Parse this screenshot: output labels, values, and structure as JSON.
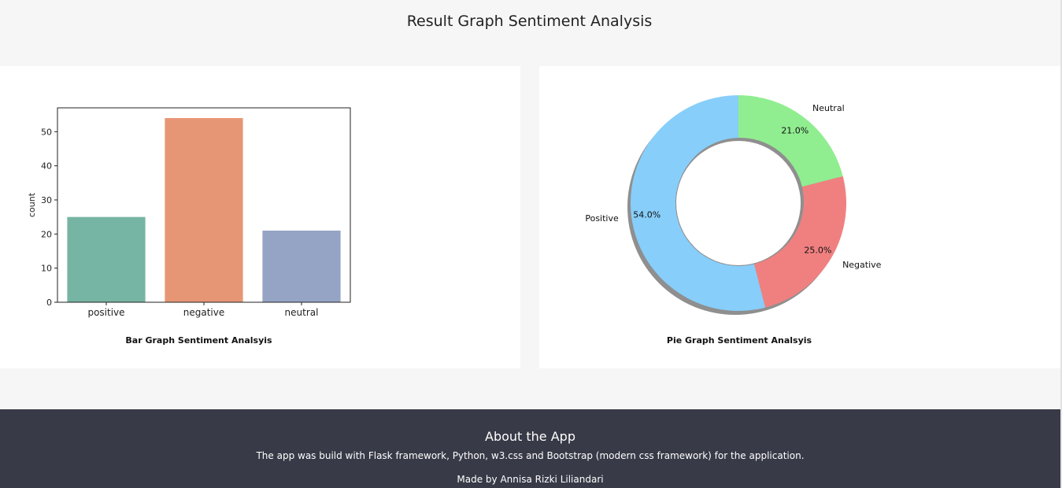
{
  "page": {
    "title": "Result Graph Sentiment Analysis"
  },
  "bar_card": {
    "caption": "Bar Graph Sentiment Analsyis"
  },
  "pie_card": {
    "caption": "Pie Graph Sentiment Analsyis"
  },
  "footer": {
    "title": "About the App",
    "text": "The app was build with Flask framework, Python, w3.css and Bootstrap (modern css framework) for the application.",
    "credit": "Made by Annisa Rizki Liliandari"
  },
  "chart_data": [
    {
      "type": "bar",
      "title": "",
      "xlabel": "",
      "ylabel": "count",
      "categories": [
        "positive",
        "negative",
        "neutral"
      ],
      "values": [
        25,
        54,
        21
      ],
      "colors": [
        "#76b5a3",
        "#e79675",
        "#95a4c4"
      ],
      "ylim": [
        0,
        57
      ],
      "yticks": [
        0,
        10,
        20,
        30,
        40,
        50
      ],
      "grid": false
    },
    {
      "type": "pie",
      "title": "",
      "donut": true,
      "labels": [
        "Neutral",
        "Negative",
        "Positive"
      ],
      "values": [
        21.0,
        25.0,
        54.0
      ],
      "value_labels": [
        "21.0%",
        "25.0%",
        "54.0%"
      ],
      "colors": [
        "#90ee90",
        "#f08080",
        "#87cefa"
      ],
      "start": "top, clockwise",
      "shadow": true
    }
  ]
}
